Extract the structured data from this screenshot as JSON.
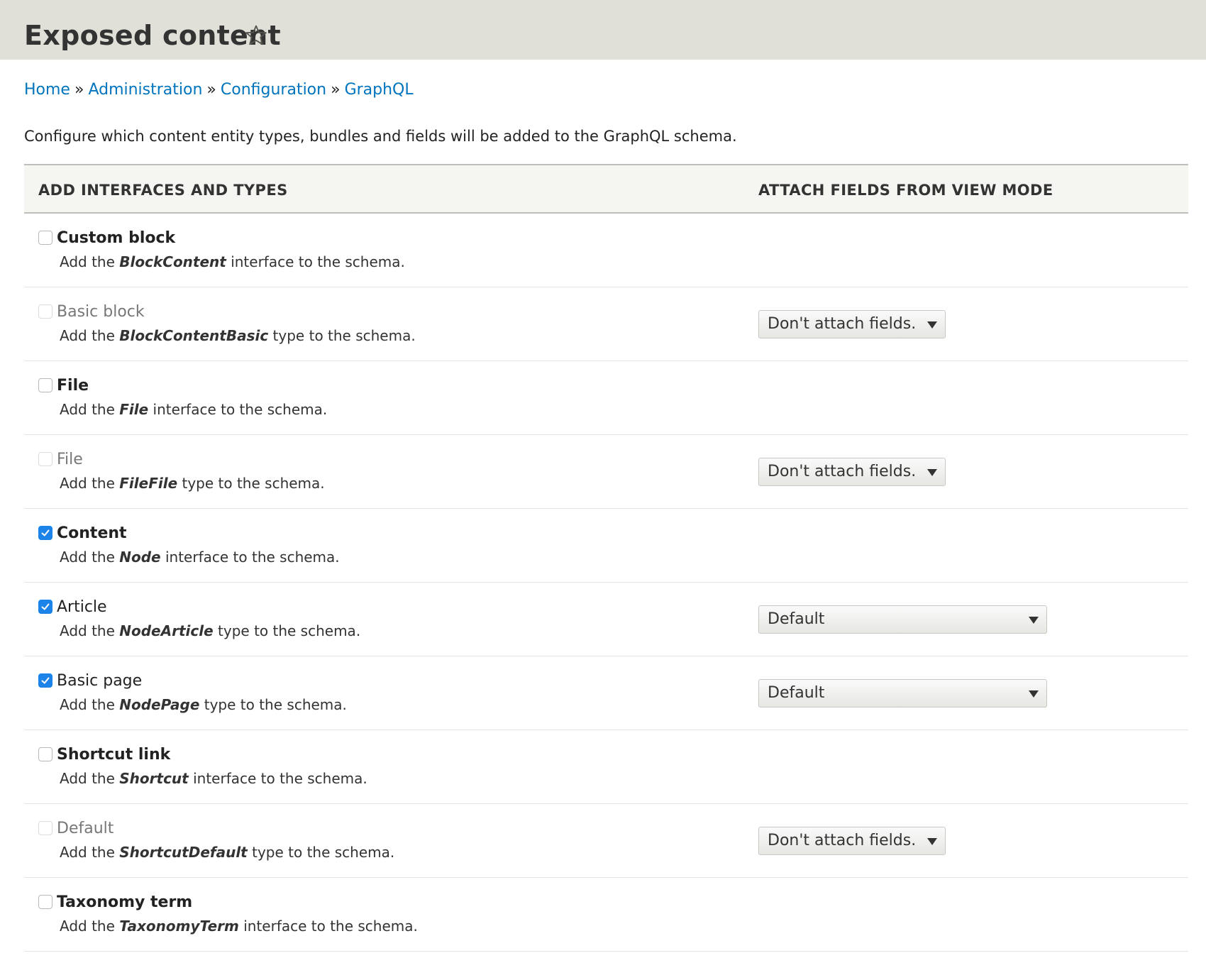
{
  "header": {
    "title": "Exposed content",
    "star_icon": "star-outline-icon"
  },
  "breadcrumb": [
    {
      "label": "Home"
    },
    {
      "label": "Administration"
    },
    {
      "label": "Configuration"
    },
    {
      "label": "GraphQL"
    }
  ],
  "breadcrumb_separator": "»",
  "description": "Configure which content entity types, bundles and fields will be added to the GraphQL schema.",
  "table": {
    "headers": {
      "types": "ADD INTERFACES AND TYPES",
      "view_mode": "ATTACH FIELDS FROM VIEW MODE"
    },
    "rows": [
      {
        "label": "Custom block",
        "desc_pre": "Add the ",
        "desc_name": "BlockContent",
        "desc_post": " interface to the schema.",
        "checked": false,
        "disabled": false,
        "kind": "interface"
      },
      {
        "label": "Basic block",
        "desc_pre": "Add the ",
        "desc_name": "BlockContentBasic",
        "desc_post": " type to the schema.",
        "checked": false,
        "disabled": true,
        "kind": "type",
        "select_value": "Don't attach fields."
      },
      {
        "label": "File",
        "desc_pre": "Add the ",
        "desc_name": "File",
        "desc_post": " interface to the schema.",
        "checked": false,
        "disabled": false,
        "kind": "interface"
      },
      {
        "label": "File",
        "desc_pre": "Add the ",
        "desc_name": "FileFile",
        "desc_post": " type to the schema.",
        "checked": false,
        "disabled": true,
        "kind": "type",
        "select_value": "Don't attach fields."
      },
      {
        "label": "Content",
        "desc_pre": "Add the ",
        "desc_name": "Node",
        "desc_post": " interface to the schema.",
        "checked": true,
        "disabled": false,
        "kind": "interface"
      },
      {
        "label": "Article",
        "desc_pre": "Add the ",
        "desc_name": "NodeArticle",
        "desc_post": " type to the schema.",
        "checked": true,
        "disabled": false,
        "kind": "type",
        "select_value": "Default"
      },
      {
        "label": "Basic page",
        "desc_pre": "Add the ",
        "desc_name": "NodePage",
        "desc_post": " type to the schema.",
        "checked": true,
        "disabled": false,
        "kind": "type",
        "select_value": "Default"
      },
      {
        "label": "Shortcut link",
        "desc_pre": "Add the ",
        "desc_name": "Shortcut",
        "desc_post": " interface to the schema.",
        "checked": false,
        "disabled": false,
        "kind": "interface"
      },
      {
        "label": "Default",
        "desc_pre": "Add the ",
        "desc_name": "ShortcutDefault",
        "desc_post": " type to the schema.",
        "checked": false,
        "disabled": true,
        "kind": "type",
        "select_value": "Don't attach fields."
      },
      {
        "label": "Taxonomy term",
        "desc_pre": "Add the ",
        "desc_name": "TaxonomyTerm",
        "desc_post": " interface to the schema.",
        "checked": false,
        "disabled": false,
        "kind": "interface"
      }
    ]
  },
  "colors": {
    "link": "#0074bd",
    "checkbox_checked": "#1c83e8",
    "header_bg": "#e0e0d8"
  },
  "icons": {
    "checkbox_check": "checkmark-icon",
    "select_arrow": "triangle-down-icon"
  }
}
